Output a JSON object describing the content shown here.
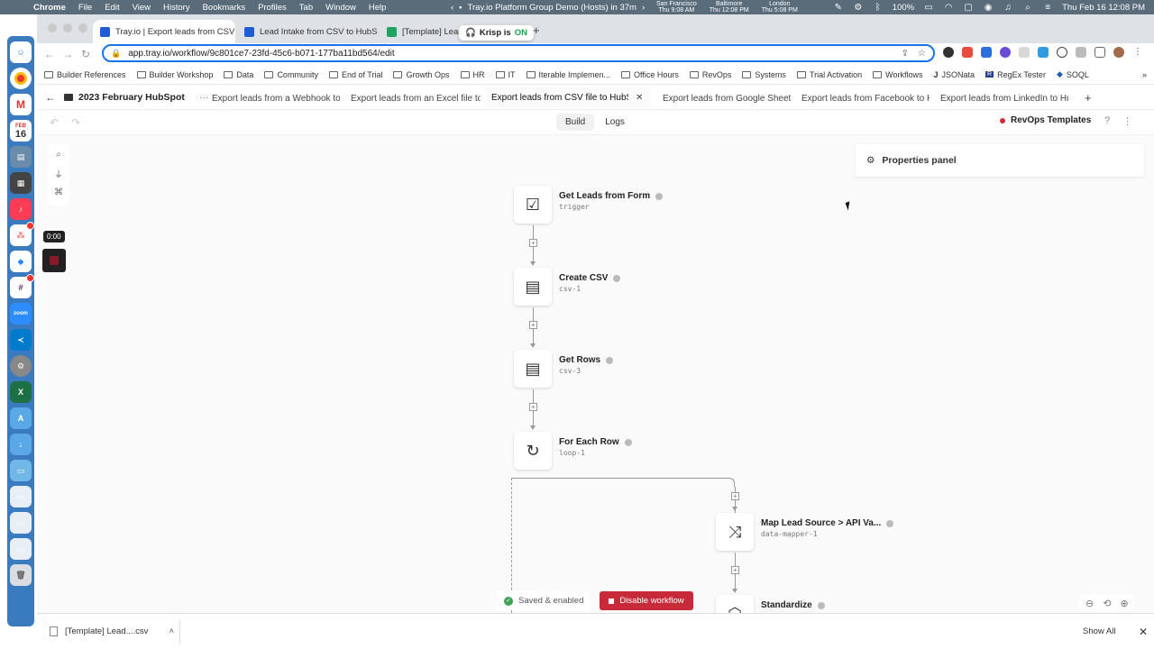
{
  "menubar": {
    "items": [
      "Chrome",
      "File",
      "Edit",
      "View",
      "History",
      "Bookmarks",
      "Profiles",
      "Tab",
      "Window",
      "Help"
    ],
    "meeting": "Tray.io Platform Group Demo (Hosts) in 37m",
    "clocks": [
      {
        "city": "San Francisco",
        "time": "Thu 9:08 AM"
      },
      {
        "city": "Baltimore",
        "time": "Thu 12:08 PM"
      },
      {
        "city": "London",
        "time": "Thu 5:08 PM"
      }
    ],
    "battery": "100%",
    "datetime": "Thu Feb 16  12:08 PM"
  },
  "dock": {
    "calendar_month": "FEB",
    "calendar_day": "16",
    "zoom_label": "zoom"
  },
  "browser": {
    "tabs": [
      {
        "title": "Tray.io | Export leads from CSV"
      },
      {
        "title": "Lead Intake from CSV to HubSp"
      },
      {
        "title": "[Template] Lead"
      }
    ],
    "krisp": {
      "label": "Krisp is",
      "state": "ON"
    },
    "url": "app.tray.io/workflow/9c801ce7-23fd-45c6-b071-177ba11bd564/edit",
    "bookmarks": [
      "Builder References",
      "Builder Workshop",
      "Data",
      "Community",
      "End of Trial",
      "Growth Ops",
      "HR",
      "IT",
      "Iterable Implemen...",
      "Office Hours",
      "RevOps",
      "Systems",
      "Trial Activation",
      "Workflows",
      "JSONata",
      "RegEx Tester",
      "SOQL"
    ]
  },
  "tray": {
    "folder": "2023 February HubSpot",
    "workflow_tabs": [
      "Export leads from a Webhook to",
      "Export leads from an Excel file to",
      "Export leads from CSV file to HubSp",
      "Export leads from Google Sheet",
      "Export leads from Facebook to H",
      "Export leads from LinkedIn to Hu"
    ],
    "build_label": "Build",
    "logs_label": "Logs",
    "project": "RevOps Templates",
    "properties_panel": "Properties panel",
    "steps": [
      {
        "title": "Get Leads from Form",
        "id": "trigger",
        "icon": "form-icon"
      },
      {
        "title": "Create CSV",
        "id": "csv-1",
        "icon": "csv-icon"
      },
      {
        "title": "Get Rows",
        "id": "csv-3",
        "icon": "csv-icon"
      },
      {
        "title": "For Each Row",
        "id": "loop-1",
        "icon": "loop-icon"
      },
      {
        "title": "Map Lead Source > API Va...",
        "id": "data-mapper-1",
        "icon": "shuffle-icon"
      },
      {
        "title": "Standardize",
        "id": "",
        "icon": "box-icon"
      }
    ],
    "status": "Saved & enabled",
    "disable_button": "Disable workflow",
    "recording_time": "0:00"
  },
  "downloads": {
    "file": "[Template] Lead....csv",
    "show_all": "Show All"
  }
}
